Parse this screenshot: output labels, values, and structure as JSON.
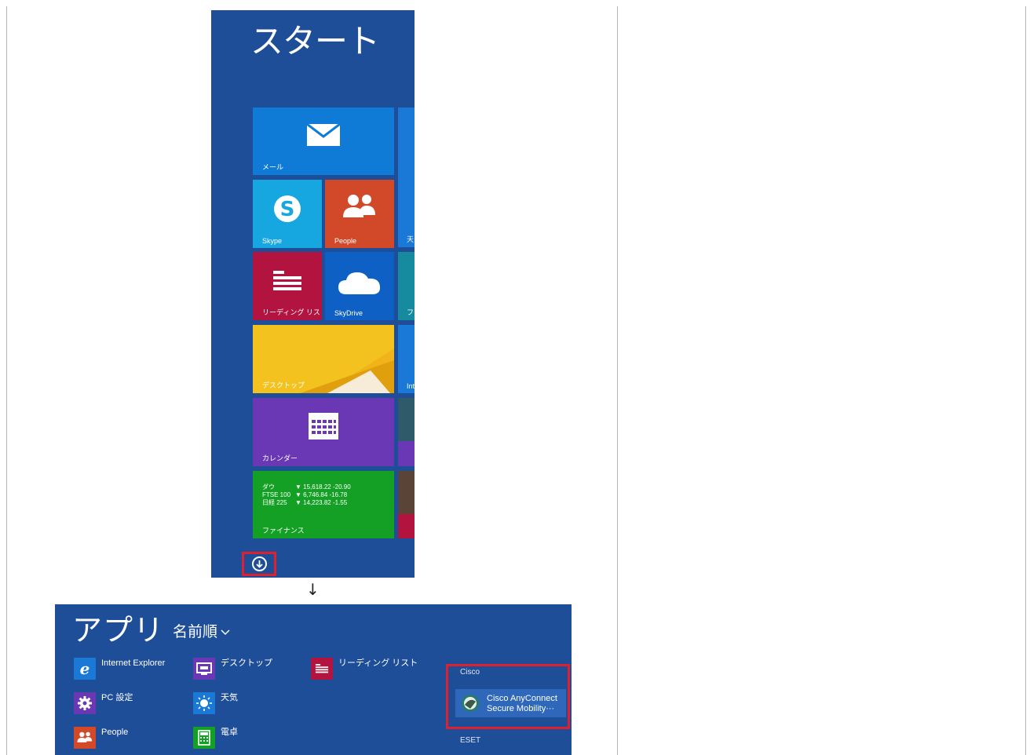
{
  "start": {
    "title": "スタート",
    "tiles": {
      "mail": {
        "label": "メール",
        "color": "#0f7bd6"
      },
      "skype": {
        "label": "Skype",
        "color": "#16a6e0"
      },
      "people": {
        "label": "People",
        "color": "#d2492a"
      },
      "reading_list": {
        "label": "リーディング リスト",
        "color": "#b3143f"
      },
      "skydrive": {
        "label": "SkyDrive",
        "color": "#0e60c4"
      },
      "desktop": {
        "label": "デスクトップ",
        "color": "#f0b31a"
      },
      "calendar": {
        "label": "カレンダー",
        "color": "#6a38b5"
      },
      "finance": {
        "label": "ファイナンス",
        "color": "#14a024",
        "rows": [
          {
            "name": "ダウ",
            "value": "▼ 15,618.22 -20.90"
          },
          {
            "name": "FTSE 100",
            "value": "▼ 6,746.84 -16.78"
          },
          {
            "name": "日経 225",
            "value": "▼ 14,223.82 -1.55"
          }
        ]
      },
      "partial_right": [
        "天",
        "フ",
        "Int"
      ]
    },
    "down_button_icon": "down-arrow-circle-icon"
  },
  "transition_arrow": "↓",
  "apps": {
    "title": "アプリ",
    "sort_label": "名前順",
    "sort_icon": "chevron-down-icon",
    "items": [
      {
        "name": "Internet Explorer",
        "icon": "ie-icon",
        "color": "#1a78d6"
      },
      {
        "name": "PC 設定",
        "icon": "gear-icon",
        "color": "#6a38b5"
      },
      {
        "name": "People",
        "icon": "people-icon",
        "color": "#d2492a"
      },
      {
        "name": "デスクトップ",
        "icon": "desktop-icon",
        "color": "#6a38b5"
      },
      {
        "name": "天気",
        "icon": "sun-icon",
        "color": "#1a78d6"
      },
      {
        "name": "電卓",
        "icon": "calculator-icon",
        "color": "#14a024"
      },
      {
        "name": "リーディング リスト",
        "icon": "reading-list-icon",
        "color": "#b3143f"
      }
    ],
    "groups": [
      {
        "name": "Cisco"
      },
      {
        "name": "ESET"
      }
    ],
    "cisco_app": {
      "name_line1": "Cisco AnyConnect",
      "name_line2": "Secure Mobility···"
    }
  }
}
